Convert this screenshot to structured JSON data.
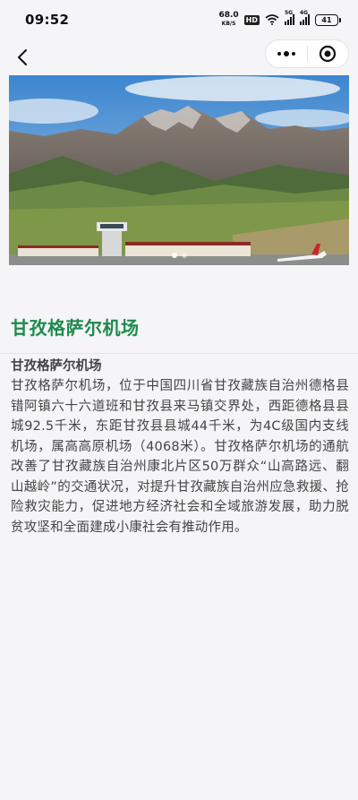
{
  "status_bar": {
    "time": "09:52",
    "net_speed_value": "68.0",
    "net_speed_unit": "KB/S",
    "hd_badge": "HD",
    "signal1_tag": "5G",
    "signal2_tag": "4G",
    "battery": "41",
    "icons": [
      "wifi-icon",
      "signal-icon",
      "signal-icon",
      "battery-icon"
    ]
  },
  "nav": {
    "back_icon": "chevron-left-icon",
    "more_icon": "more-dots-icon",
    "close_icon": "close-target-icon"
  },
  "banner": {
    "slide_count": 2,
    "active_slide": 0
  },
  "page": {
    "title": "甘孜格萨尔机场",
    "heading": "甘孜格萨尔机场",
    "body": "甘孜格萨尔机场，位于中国四川省甘孜藏族自治州德格县错阿镇六十六道班和甘孜县来马镇交界处，西距德格县县城92.5千米，东距甘孜县县城44千米，为4C级国内支线机场，属高高原机场（4068米）。甘孜格萨尔机场的通航改善了甘孜藏族自治州康北片区50万群众“山高路远、翻山越岭”的交通状况，对提升甘孜藏族自治州应急救援、抢险救灾能力，促进地方经济社会和全域旅游发展，助力脱贫攻坚和全面建成小康社会有推动作用。"
  },
  "colors": {
    "title": "#1e8a4f",
    "background": "#f5f5f7"
  }
}
